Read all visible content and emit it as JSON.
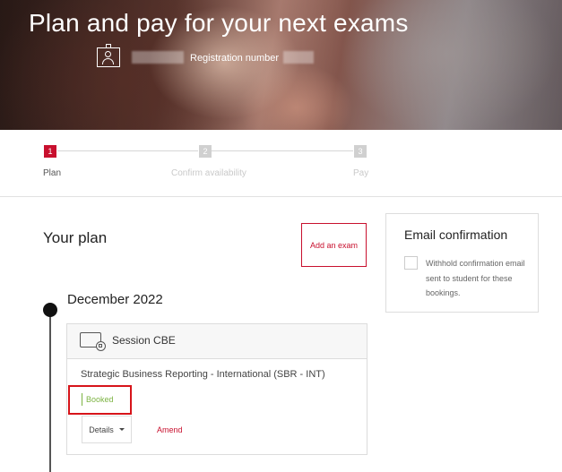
{
  "hero": {
    "title": "Plan and pay for your next exams",
    "registration_label": "Registration number"
  },
  "stepper": {
    "steps": [
      {
        "number": "1",
        "label": "Plan",
        "active": true
      },
      {
        "number": "2",
        "label": "Confirm availability",
        "active": false
      },
      {
        "number": "3",
        "label": "Pay",
        "active": false
      }
    ]
  },
  "plan": {
    "heading": "Your plan",
    "add_exam_label": "Add an exam",
    "month": "December 2022",
    "session": {
      "type_label": "Session CBE",
      "exam_name": "Strategic Business Reporting - International (SBR - INT)",
      "status": "Booked",
      "details_label": "Details",
      "amend_label": "Amend"
    }
  },
  "email_confirmation": {
    "title": "Email confirmation",
    "checkbox_text": "Withhold confirmation email sent to student for these bookings.",
    "checked": false
  },
  "colors": {
    "accent": "#c8102e",
    "booked": "#7cb342"
  },
  "icons": [
    "id-card-icon",
    "computer-exam-icon",
    "caret-down-icon",
    "timeline-dot"
  ]
}
